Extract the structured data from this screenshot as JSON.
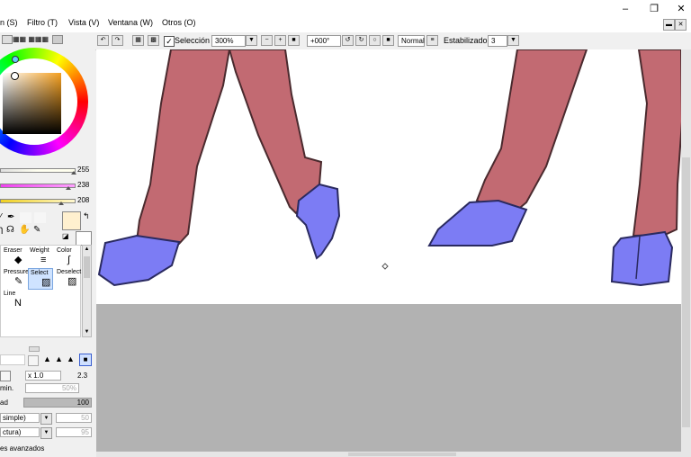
{
  "menu": {
    "items": [
      "n (S)",
      "Filtro (T)",
      "Vista (V)",
      "Ventana (W)",
      "Otros (O)"
    ]
  },
  "toolbar": {
    "selection_label": "Selección",
    "zoom": "300%",
    "rotation": "+000°",
    "blend_mode": "Normal",
    "stabilizer_label": "Estabilizador",
    "stabilizer_value": "3"
  },
  "color_panel": {
    "selected_color": "#fff0cf",
    "sliders": [
      {
        "value": "255",
        "level": 1.0
      },
      {
        "value": "238",
        "level": 0.93
      },
      {
        "value": "208",
        "level": 0.82
      }
    ]
  },
  "tools": {
    "cells": [
      {
        "label": "Eraser",
        "icon": "eraser-icon",
        "glyph": "◆"
      },
      {
        "label": "Weight",
        "icon": "weight-icon",
        "glyph": "≡"
      },
      {
        "label": "Color",
        "icon": "color-icon",
        "glyph": "∫"
      },
      {
        "label": "Pressure",
        "icon": "pressure-icon",
        "glyph": "✎"
      },
      {
        "label": "Select",
        "icon": "select-icon",
        "glyph": "▨"
      },
      {
        "label": "Deselect",
        "icon": "deselect-icon",
        "glyph": "▨"
      },
      {
        "label": "Line",
        "icon": "line-icon",
        "glyph": "N"
      }
    ]
  },
  "brush_props": {
    "size_multiplier": "x 1.0",
    "size_value": "2.3",
    "min_label": "min.",
    "min_value": "50%",
    "density_label": "ad",
    "density_value": "100",
    "shape_select": " simple)",
    "shape_value": "50",
    "texture_select": "ctura)",
    "texture_value": "95",
    "advanced_label": "es avanzados"
  },
  "colors": {
    "leg_fill": "#c26a72",
    "hoof_fill": "#7c7cf4",
    "canvas_bg": "#ffffff",
    "workspace_bg": "#b2b2b2"
  }
}
